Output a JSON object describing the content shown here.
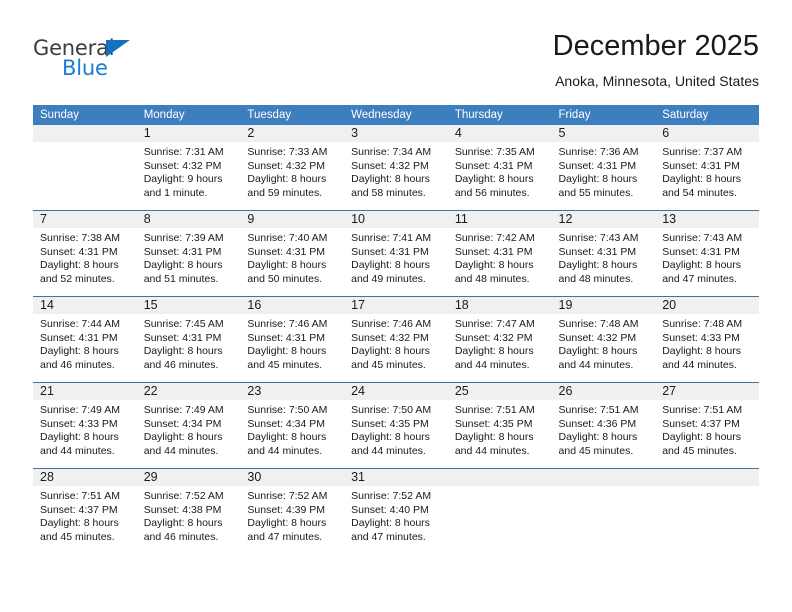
{
  "brand": {
    "name_top": "General",
    "name_bottom": "Blue",
    "triangle_color": "#166fc1",
    "top_color": "#3d3d3d",
    "bottom_color": "#1a7cd4"
  },
  "header": {
    "title": "December 2025",
    "subtitle": "Anoka, Minnesota, United States"
  },
  "theme": {
    "header_bar": "#3d7ebf",
    "daynum_band": "#f0f0f0",
    "row_separator": "#46719e",
    "text": "#1a1a1a"
  },
  "weekday_headers": [
    "Sunday",
    "Monday",
    "Tuesday",
    "Wednesday",
    "Thursday",
    "Friday",
    "Saturday"
  ],
  "weeks": [
    [
      {
        "day": "",
        "sunrise": "",
        "sunset": "",
        "daylight_line1": "",
        "daylight_line2": ""
      },
      {
        "day": "1",
        "sunrise": "Sunrise: 7:31 AM",
        "sunset": "Sunset: 4:32 PM",
        "daylight_line1": "Daylight: 9 hours",
        "daylight_line2": "and 1 minute."
      },
      {
        "day": "2",
        "sunrise": "Sunrise: 7:33 AM",
        "sunset": "Sunset: 4:32 PM",
        "daylight_line1": "Daylight: 8 hours",
        "daylight_line2": "and 59 minutes."
      },
      {
        "day": "3",
        "sunrise": "Sunrise: 7:34 AM",
        "sunset": "Sunset: 4:32 PM",
        "daylight_line1": "Daylight: 8 hours",
        "daylight_line2": "and 58 minutes."
      },
      {
        "day": "4",
        "sunrise": "Sunrise: 7:35 AM",
        "sunset": "Sunset: 4:31 PM",
        "daylight_line1": "Daylight: 8 hours",
        "daylight_line2": "and 56 minutes."
      },
      {
        "day": "5",
        "sunrise": "Sunrise: 7:36 AM",
        "sunset": "Sunset: 4:31 PM",
        "daylight_line1": "Daylight: 8 hours",
        "daylight_line2": "and 55 minutes."
      },
      {
        "day": "6",
        "sunrise": "Sunrise: 7:37 AM",
        "sunset": "Sunset: 4:31 PM",
        "daylight_line1": "Daylight: 8 hours",
        "daylight_line2": "and 54 minutes."
      }
    ],
    [
      {
        "day": "7",
        "sunrise": "Sunrise: 7:38 AM",
        "sunset": "Sunset: 4:31 PM",
        "daylight_line1": "Daylight: 8 hours",
        "daylight_line2": "and 52 minutes."
      },
      {
        "day": "8",
        "sunrise": "Sunrise: 7:39 AM",
        "sunset": "Sunset: 4:31 PM",
        "daylight_line1": "Daylight: 8 hours",
        "daylight_line2": "and 51 minutes."
      },
      {
        "day": "9",
        "sunrise": "Sunrise: 7:40 AM",
        "sunset": "Sunset: 4:31 PM",
        "daylight_line1": "Daylight: 8 hours",
        "daylight_line2": "and 50 minutes."
      },
      {
        "day": "10",
        "sunrise": "Sunrise: 7:41 AM",
        "sunset": "Sunset: 4:31 PM",
        "daylight_line1": "Daylight: 8 hours",
        "daylight_line2": "and 49 minutes."
      },
      {
        "day": "11",
        "sunrise": "Sunrise: 7:42 AM",
        "sunset": "Sunset: 4:31 PM",
        "daylight_line1": "Daylight: 8 hours",
        "daylight_line2": "and 48 minutes."
      },
      {
        "day": "12",
        "sunrise": "Sunrise: 7:43 AM",
        "sunset": "Sunset: 4:31 PM",
        "daylight_line1": "Daylight: 8 hours",
        "daylight_line2": "and 48 minutes."
      },
      {
        "day": "13",
        "sunrise": "Sunrise: 7:43 AM",
        "sunset": "Sunset: 4:31 PM",
        "daylight_line1": "Daylight: 8 hours",
        "daylight_line2": "and 47 minutes."
      }
    ],
    [
      {
        "day": "14",
        "sunrise": "Sunrise: 7:44 AM",
        "sunset": "Sunset: 4:31 PM",
        "daylight_line1": "Daylight: 8 hours",
        "daylight_line2": "and 46 minutes."
      },
      {
        "day": "15",
        "sunrise": "Sunrise: 7:45 AM",
        "sunset": "Sunset: 4:31 PM",
        "daylight_line1": "Daylight: 8 hours",
        "daylight_line2": "and 46 minutes."
      },
      {
        "day": "16",
        "sunrise": "Sunrise: 7:46 AM",
        "sunset": "Sunset: 4:31 PM",
        "daylight_line1": "Daylight: 8 hours",
        "daylight_line2": "and 45 minutes."
      },
      {
        "day": "17",
        "sunrise": "Sunrise: 7:46 AM",
        "sunset": "Sunset: 4:32 PM",
        "daylight_line1": "Daylight: 8 hours",
        "daylight_line2": "and 45 minutes."
      },
      {
        "day": "18",
        "sunrise": "Sunrise: 7:47 AM",
        "sunset": "Sunset: 4:32 PM",
        "daylight_line1": "Daylight: 8 hours",
        "daylight_line2": "and 44 minutes."
      },
      {
        "day": "19",
        "sunrise": "Sunrise: 7:48 AM",
        "sunset": "Sunset: 4:32 PM",
        "daylight_line1": "Daylight: 8 hours",
        "daylight_line2": "and 44 minutes."
      },
      {
        "day": "20",
        "sunrise": "Sunrise: 7:48 AM",
        "sunset": "Sunset: 4:33 PM",
        "daylight_line1": "Daylight: 8 hours",
        "daylight_line2": "and 44 minutes."
      }
    ],
    [
      {
        "day": "21",
        "sunrise": "Sunrise: 7:49 AM",
        "sunset": "Sunset: 4:33 PM",
        "daylight_line1": "Daylight: 8 hours",
        "daylight_line2": "and 44 minutes."
      },
      {
        "day": "22",
        "sunrise": "Sunrise: 7:49 AM",
        "sunset": "Sunset: 4:34 PM",
        "daylight_line1": "Daylight: 8 hours",
        "daylight_line2": "and 44 minutes."
      },
      {
        "day": "23",
        "sunrise": "Sunrise: 7:50 AM",
        "sunset": "Sunset: 4:34 PM",
        "daylight_line1": "Daylight: 8 hours",
        "daylight_line2": "and 44 minutes."
      },
      {
        "day": "24",
        "sunrise": "Sunrise: 7:50 AM",
        "sunset": "Sunset: 4:35 PM",
        "daylight_line1": "Daylight: 8 hours",
        "daylight_line2": "and 44 minutes."
      },
      {
        "day": "25",
        "sunrise": "Sunrise: 7:51 AM",
        "sunset": "Sunset: 4:35 PM",
        "daylight_line1": "Daylight: 8 hours",
        "daylight_line2": "and 44 minutes."
      },
      {
        "day": "26",
        "sunrise": "Sunrise: 7:51 AM",
        "sunset": "Sunset: 4:36 PM",
        "daylight_line1": "Daylight: 8 hours",
        "daylight_line2": "and 45 minutes."
      },
      {
        "day": "27",
        "sunrise": "Sunrise: 7:51 AM",
        "sunset": "Sunset: 4:37 PM",
        "daylight_line1": "Daylight: 8 hours",
        "daylight_line2": "and 45 minutes."
      }
    ],
    [
      {
        "day": "28",
        "sunrise": "Sunrise: 7:51 AM",
        "sunset": "Sunset: 4:37 PM",
        "daylight_line1": "Daylight: 8 hours",
        "daylight_line2": "and 45 minutes."
      },
      {
        "day": "29",
        "sunrise": "Sunrise: 7:52 AM",
        "sunset": "Sunset: 4:38 PM",
        "daylight_line1": "Daylight: 8 hours",
        "daylight_line2": "and 46 minutes."
      },
      {
        "day": "30",
        "sunrise": "Sunrise: 7:52 AM",
        "sunset": "Sunset: 4:39 PM",
        "daylight_line1": "Daylight: 8 hours",
        "daylight_line2": "and 47 minutes."
      },
      {
        "day": "31",
        "sunrise": "Sunrise: 7:52 AM",
        "sunset": "Sunset: 4:40 PM",
        "daylight_line1": "Daylight: 8 hours",
        "daylight_line2": "and 47 minutes."
      },
      {
        "day": "",
        "sunrise": "",
        "sunset": "",
        "daylight_line1": "",
        "daylight_line2": ""
      },
      {
        "day": "",
        "sunrise": "",
        "sunset": "",
        "daylight_line1": "",
        "daylight_line2": ""
      },
      {
        "day": "",
        "sunrise": "",
        "sunset": "",
        "daylight_line1": "",
        "daylight_line2": ""
      }
    ]
  ]
}
